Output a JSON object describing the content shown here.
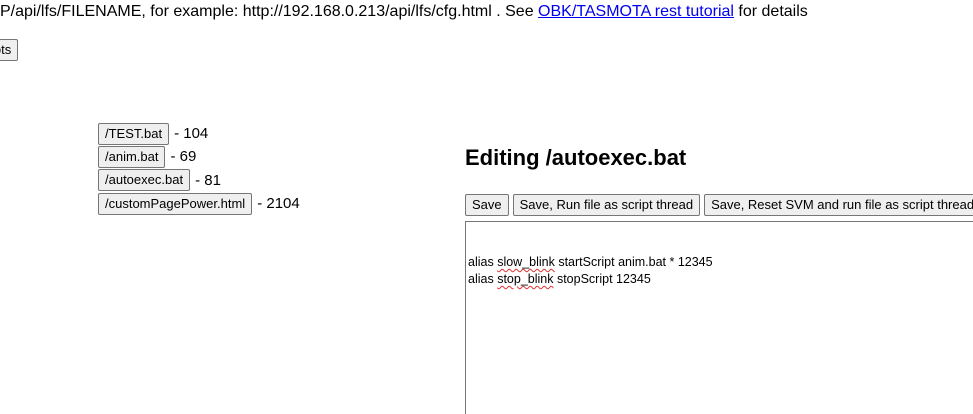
{
  "header": {
    "text_before": "P/api/lfs/FILENAME, for example: http://192.168.0.213/api/lfs/cfg.html . See ",
    "link_label": "OBK/TASMOTA rest tutorial",
    "text_after": " for details"
  },
  "scripts_button_label": "ipts",
  "files": [
    {
      "name": "/TEST.bat",
      "size": "104"
    },
    {
      "name": "/anim.bat",
      "size": "69"
    },
    {
      "name": "/autoexec.bat",
      "size": "81"
    },
    {
      "name": "/customPagePower.html",
      "size": "2104"
    }
  ],
  "editor": {
    "title": "Editing /autoexec.bat",
    "buttons": {
      "save": "Save",
      "save_run": "Save, Run file as script thread",
      "save_reset": "Save, Reset SVM and run file as script thread"
    },
    "lines": [
      {
        "prefix": "alias ",
        "word": "slow_blink",
        "rest": " startScript anim.bat * 12345"
      },
      {
        "prefix": "alias ",
        "word": "stop_blink",
        "rest": " stopScript 12345"
      }
    ]
  }
}
